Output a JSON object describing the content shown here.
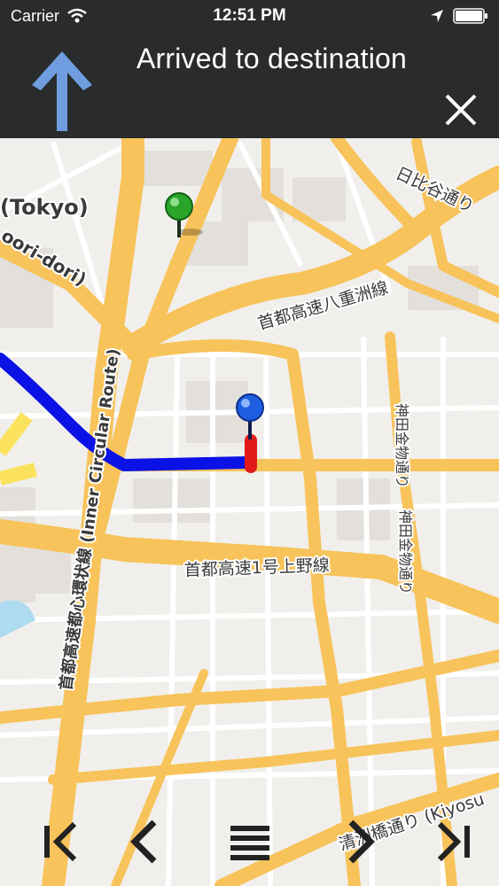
{
  "status_bar": {
    "carrier": "Carrier",
    "time": "12:51 PM",
    "icons": [
      "wifi-icon",
      "location-arrow-icon",
      "battery-icon"
    ]
  },
  "nav_header": {
    "title": "Arrived to destination",
    "turn_icon": "arrow-up-icon",
    "close_icon": "close-icon"
  },
  "map": {
    "labels": {
      "city": "(Tokyo)",
      "yaesu_street": "oori-dori)",
      "hibiya_street": "日比谷通り",
      "expressway_yaesu": "首都高速八重洲線",
      "inner_circular": "首都高速都心環状線 (Inner Circular Route)",
      "expressway_ueno": "首都高速1号上野線",
      "kanda_street_1": "神田金物通り",
      "kanda_street_2": "神田金物通り",
      "kiyosu_street": "清洲橋通り (Kiyosu"
    },
    "markers": [
      "green-pin-icon",
      "blue-pin-icon"
    ]
  },
  "toolbar": {
    "buttons": [
      "first-step-icon",
      "previous-step-icon",
      "list-icon",
      "next-step-icon",
      "last-step-icon"
    ]
  },
  "colors": {
    "header_bg": "#2a2b2c",
    "turn_arrow": "#6f9de0",
    "route": "#0a12e6",
    "route_end": "#e11b1b",
    "road": "#f7c35a",
    "map_bg": "#f1efec"
  }
}
